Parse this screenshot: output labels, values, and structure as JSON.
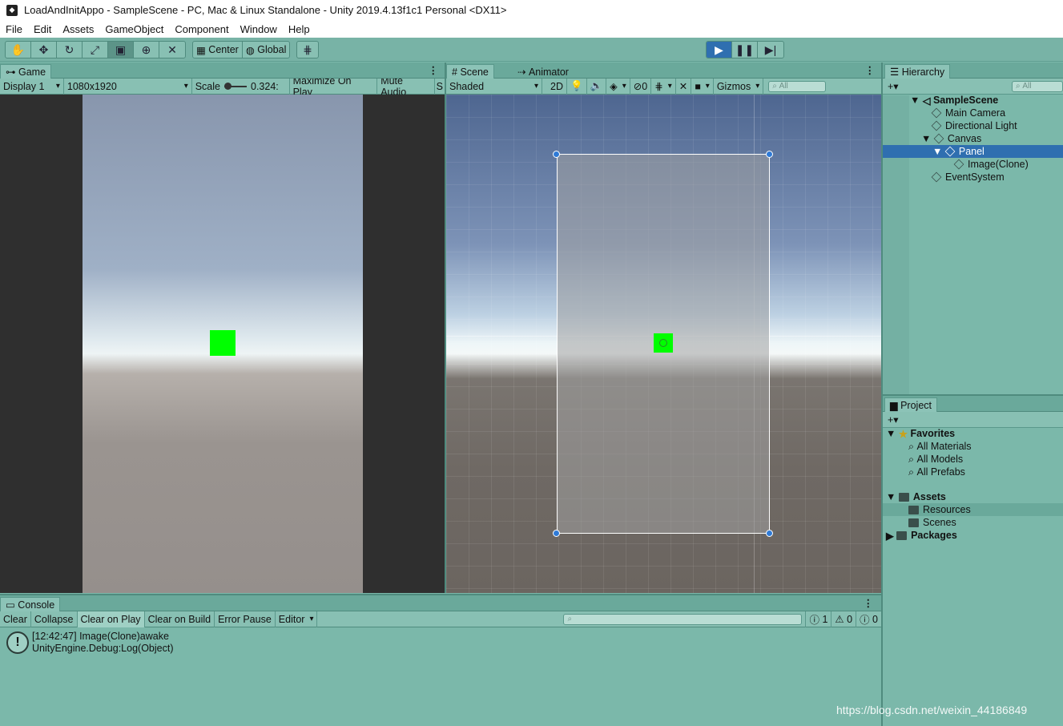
{
  "window": {
    "title": "LoadAndInitAppo - SampleScene - PC, Mac & Linux Standalone - Unity 2019.4.13f1c1 Personal <DX11>"
  },
  "menu": [
    "File",
    "Edit",
    "Assets",
    "GameObject",
    "Component",
    "Window",
    "Help"
  ],
  "toolbar": {
    "center_label": "Center",
    "global_label": "Global"
  },
  "game": {
    "tab_label": "Game",
    "display": "Display 1",
    "resolution": "1080x1920",
    "scale_label": "Scale",
    "scale_value": "0.324:",
    "maximize": "Maximize On Play",
    "mute": "Mute Audio",
    "stats_cut": "S"
  },
  "scene": {
    "tab_label": "Scene",
    "animator_label": "Animator",
    "shading": "Shaded",
    "mode_2d": "2D",
    "hidden_count": "0",
    "gizmos": "Gizmos",
    "search_placeholder": "All"
  },
  "hierarchy": {
    "tab_label": "Hierarchy",
    "search_placeholder": "All",
    "scene_name": "SampleScene",
    "items": [
      "Main Camera",
      "Directional Light",
      "Canvas",
      "Panel",
      "Image(Clone)",
      "EventSystem"
    ]
  },
  "project": {
    "tab_label": "Project",
    "favorites": "Favorites",
    "fav_items": [
      "All Materials",
      "All Models",
      "All Prefabs"
    ],
    "assets": "Assets",
    "asset_items": [
      "Resources",
      "Scenes"
    ],
    "packages": "Packages"
  },
  "console": {
    "tab_label": "Console",
    "buttons": [
      "Clear",
      "Collapse",
      "Clear on Play",
      "Clear on Build",
      "Error Pause"
    ],
    "editor_dropdown": "Editor",
    "log_count": "1",
    "warn_count": "0",
    "error_count": "0",
    "entry_line1": "[12:42:47] Image(Clone)awake",
    "entry_line2": "UnityEngine.Debug:Log(Object)"
  },
  "watermark": "https://blog.csdn.net/weixin_44186849",
  "colors": {
    "accent": "#2f6fb0",
    "green_square": "#00ff00",
    "panel_bg": "#7bb8aa"
  }
}
